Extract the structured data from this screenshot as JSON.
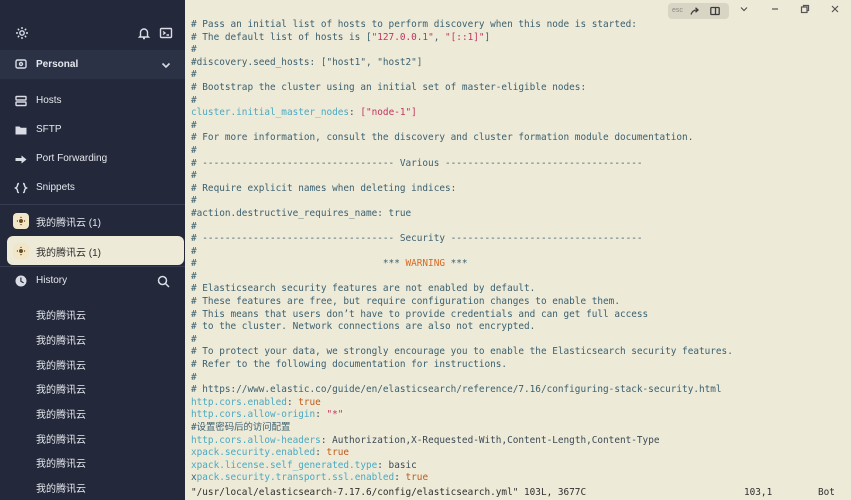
{
  "sidebar": {
    "vault": "Personal",
    "nav": [
      {
        "label": "Hosts",
        "icon": "hosts-icon"
      },
      {
        "label": "SFTP",
        "icon": "folder-icon"
      },
      {
        "label": "Port Forwarding",
        "icon": "port-forwarding-icon"
      },
      {
        "label": "Snippets",
        "icon": "snippets-icon"
      }
    ],
    "groups": [
      {
        "label": "我的腾讯云 (1)",
        "active": false
      },
      {
        "label": "我的腾讯云 (1)",
        "active": true
      }
    ],
    "history": {
      "title": "History",
      "items": [
        "我的腾讯云",
        "我的腾讯云",
        "我的腾讯云",
        "我的腾讯云",
        "我的腾讯云",
        "我的腾讯云",
        "我的腾讯云",
        "我的腾讯云"
      ]
    }
  },
  "toolbar": {
    "esc_label": "esc"
  },
  "terminal": {
    "lines": [
      [
        {
          "t": "# Pass an initial list of hosts to perform discovery when this node is started:",
          "c": "comment"
        }
      ],
      [
        {
          "t": "# The default list of hosts is [",
          "c": "comment"
        },
        {
          "t": "\"127.0.0.1\"",
          "c": "str"
        },
        {
          "t": ", ",
          "c": "comment"
        },
        {
          "t": "\"[::1]\"",
          "c": "str"
        },
        {
          "t": "]",
          "c": "comment"
        }
      ],
      [
        {
          "t": "#",
          "c": "comment"
        }
      ],
      [
        {
          "t": "#discovery.seed_hosts: [\"host1\", \"host2\"]",
          "c": "comment"
        }
      ],
      [
        {
          "t": "#",
          "c": "comment"
        }
      ],
      [
        {
          "t": "# Bootstrap the cluster using an initial set of master-eligible nodes:",
          "c": "comment"
        }
      ],
      [
        {
          "t": "#",
          "c": "comment"
        }
      ],
      [
        {
          "t": "cluster.initial_master_nodes",
          "c": "key"
        },
        {
          "t": ": ",
          "c": "plain"
        },
        {
          "t": "[\"node-1\"]",
          "c": "str"
        }
      ],
      [
        {
          "t": "#",
          "c": "comment"
        }
      ],
      [
        {
          "t": "# For more information, consult the discovery and cluster formation module documentation.",
          "c": "comment"
        }
      ],
      [
        {
          "t": "#",
          "c": "comment"
        }
      ],
      [
        {
          "t": "# ---------------------------------- Various -----------------------------------",
          "c": "comment"
        }
      ],
      [
        {
          "t": "#",
          "c": "comment"
        }
      ],
      [
        {
          "t": "# Require explicit names when deleting indices:",
          "c": "comment"
        }
      ],
      [
        {
          "t": "#",
          "c": "comment"
        }
      ],
      [
        {
          "t": "#action.destructive_requires_name: true",
          "c": "comment"
        }
      ],
      [
        {
          "t": "#",
          "c": "comment"
        }
      ],
      [
        {
          "t": "# ---------------------------------- Security ----------------------------------",
          "c": "comment"
        }
      ],
      [
        {
          "t": "#",
          "c": "comment"
        }
      ],
      [
        {
          "t": "#                                 *** ",
          "c": "comment"
        },
        {
          "t": "WARNING",
          "c": "warn"
        },
        {
          "t": " ***",
          "c": "comment"
        }
      ],
      [
        {
          "t": "#",
          "c": "comment"
        }
      ],
      [
        {
          "t": "# Elasticsearch security features are not enabled by default.",
          "c": "comment"
        }
      ],
      [
        {
          "t": "# These features are free, but require configuration changes to enable them.",
          "c": "comment"
        }
      ],
      [
        {
          "t": "# This means that users don’t have to provide credentials and can get full access",
          "c": "comment"
        }
      ],
      [
        {
          "t": "# to the cluster. Network connections are also not encrypted.",
          "c": "comment"
        }
      ],
      [
        {
          "t": "#",
          "c": "comment"
        }
      ],
      [
        {
          "t": "# To protect your data, we strongly encourage you to enable the Elasticsearch security features.",
          "c": "comment"
        }
      ],
      [
        {
          "t": "# Refer to the following documentation for instructions.",
          "c": "comment"
        }
      ],
      [
        {
          "t": "#",
          "c": "comment"
        }
      ],
      [
        {
          "t": "# https://www.elastic.co/guide/en/elasticsearch/reference/7.16/configuring-stack-security.html",
          "c": "comment"
        }
      ],
      [
        {
          "t": "http.cors.enabled",
          "c": "key"
        },
        {
          "t": ": ",
          "c": "plain"
        },
        {
          "t": "true",
          "c": "bool"
        }
      ],
      [
        {
          "t": "http.cors.allow-origin",
          "c": "key"
        },
        {
          "t": ": ",
          "c": "plain"
        },
        {
          "t": "\"*\"",
          "c": "str"
        }
      ],
      [
        {
          "t": "#设置密码后的访问配置",
          "c": "comment"
        }
      ],
      [
        {
          "t": "http.cors.allow-headers",
          "c": "key"
        },
        {
          "t": ": Authorization,X-Requested-With,Content-Length,Content-Type",
          "c": "plain"
        }
      ],
      [
        {
          "t": "xpack.security.enabled",
          "c": "key"
        },
        {
          "t": ": ",
          "c": "plain"
        },
        {
          "t": "true",
          "c": "bool"
        }
      ],
      [
        {
          "t": "xpack.license.self_generated.type",
          "c": "key"
        },
        {
          "t": ": basic",
          "c": "plain"
        }
      ],
      [
        {
          "t": "x",
          "c": "cursor"
        },
        {
          "t": "pack.security.transport.ssl.enabled",
          "c": "key"
        },
        {
          "t": ": ",
          "c": "plain"
        },
        {
          "t": "true",
          "c": "bool"
        }
      ]
    ],
    "status_file": "\"/usr/local/elasticsearch-7.17.6/config/elasticsearch.yml\" 103L, 3677C",
    "status_pos": "103,1",
    "status_scroll": "Bot"
  },
  "colors": {
    "sidebar_bg": "#23283a",
    "terminal_bg": "#eeead8",
    "key": "#4aa9c2",
    "string": "#c2345f",
    "warning": "#d66a25"
  }
}
